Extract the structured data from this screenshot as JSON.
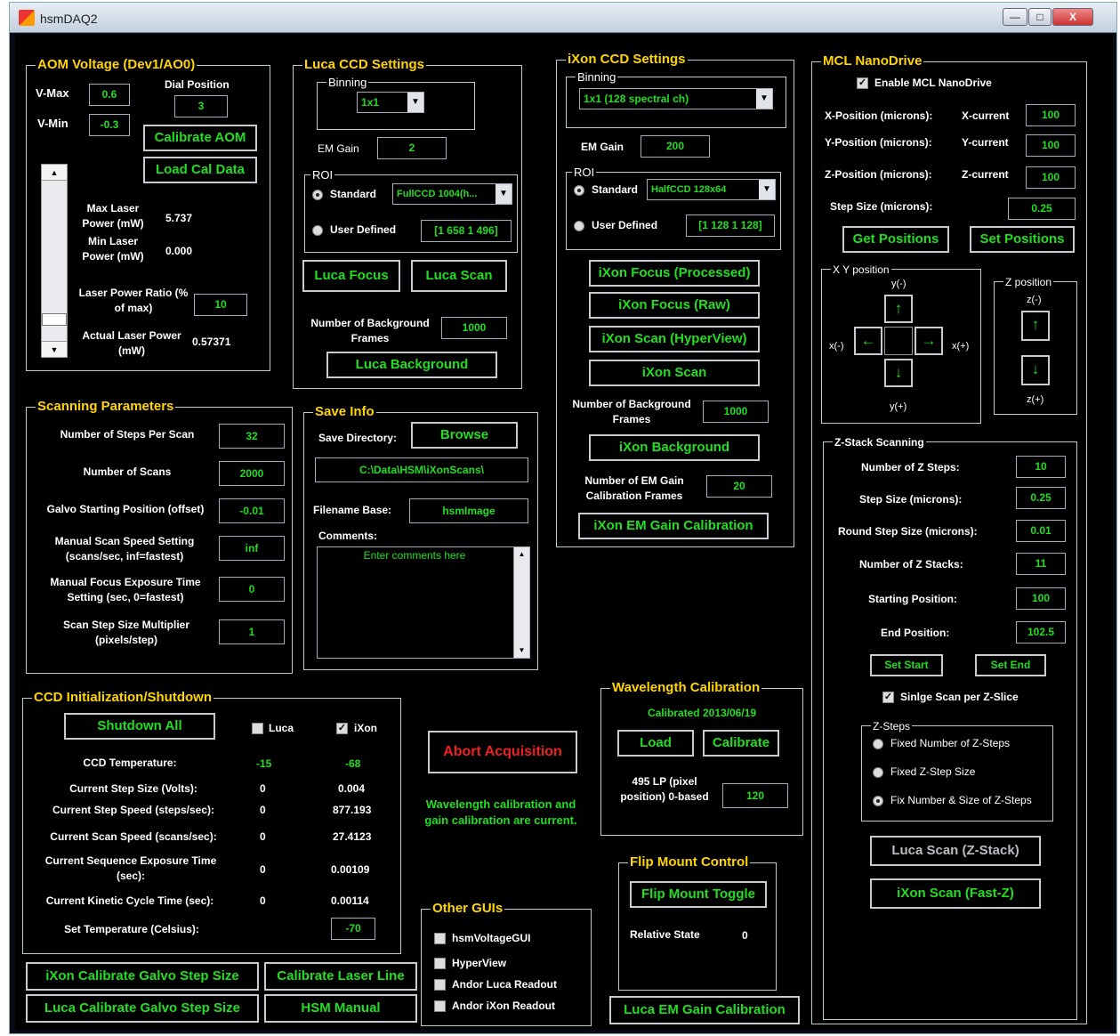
{
  "window": {
    "title": "hsmDAQ2",
    "min": "—",
    "max": "□",
    "close": "X"
  },
  "aom": {
    "title": "AOM Voltage (Dev1/AO0)",
    "vmax_label": "V-Max",
    "vmax": "0.6",
    "vmin_label": "V-Min",
    "vmin": "-0.3",
    "dial_label": "Dial Position",
    "dial": "3",
    "calibrate": "Calibrate AOM",
    "load": "Load Cal Data",
    "max_label": "Max Laser Power (mW)",
    "max": "5.737",
    "min_label": "Min Laser Power (mW)",
    "min": "0.000",
    "ratio_label": "Laser Power Ratio (% of max)",
    "ratio": "10",
    "actual_label": "Actual Laser Power (mW)",
    "actual": "0.57371",
    "slider_up": "▲",
    "slider_down": "▼",
    "slider_level": 0.1
  },
  "luca": {
    "title": "Luca CCD Settings",
    "binning_title": "Binning",
    "binning": "1x1",
    "emgain_label": "EM Gain",
    "emgain": "2",
    "roi_title": "ROI",
    "standard_label": "Standard",
    "standard_value": "FullCCD 1004(h...",
    "user_label": "User Defined",
    "user_value": "[1 658 1 496]",
    "focus": "Luca Focus",
    "scan": "Luca Scan",
    "bg_label": "Number of Background Frames",
    "bg": "1000",
    "background": "Luca Background"
  },
  "ixon": {
    "title": "iXon CCD Settings",
    "binning_title": "Binning",
    "binning": "1x1  (128 spectral ch)",
    "emgain_label": "EM Gain",
    "emgain": "200",
    "roi_title": "ROI",
    "standard_label": "Standard",
    "standard_value": "HalfCCD 128x64",
    "user_label": "User Defined",
    "user_value": "[1 128 1 128]",
    "focus_processed": "iXon Focus (Processed)",
    "focus_raw": "iXon Focus (Raw)",
    "scan_hyper": "iXon Scan (HyperView)",
    "scan": "iXon Scan",
    "bg_label": "Number of Background Frames",
    "bg": "1000",
    "background": "iXon Background",
    "emcal_label": "Number of EM Gain Calibration Frames",
    "emcal": "20",
    "emcal_btn": "iXon EM Gain Calibration"
  },
  "mcl": {
    "title": "MCL NanoDrive",
    "enable": "Enable MCL NanoDrive",
    "xpos_label": "X-Position (microns):",
    "xcur_label": "X-current",
    "xcur": "100",
    "ypos_label": "Y-Position  (microns):",
    "ycur_label": "Y-current",
    "ycur": "100",
    "zpos_label": "Z-Position  (microns):",
    "zcur_label": "Z-current",
    "zcur": "100",
    "step_label": "Step Size (microns):",
    "step": "0.25",
    "get": "Get Positions",
    "set": "Set Positions",
    "xy_title": "X Y position",
    "y_minus": "y(-)",
    "y_plus": "y(+)",
    "x_minus": "x(-)",
    "x_plus": "x(+)",
    "z_title": "Z position",
    "z_minus": "z(-)",
    "z_plus": "z(+)",
    "up": "↑",
    "down": "↓",
    "left": "←",
    "right": "→"
  },
  "zstack": {
    "title": "Z-Stack Scanning",
    "nsteps_label": "Number of Z Steps:",
    "nsteps": "10",
    "step_label": "Step Size (microns):",
    "step": "0.25",
    "round_label": "Round Step Size (microns):",
    "round": "0.01",
    "nstacks_label": "Number of Z Stacks:",
    "nstacks": "11",
    "start_label": "Starting Position:",
    "start": "100",
    "end_label": "End Position:",
    "end": "102.5",
    "set_start": "Set Start",
    "set_end": "Set End",
    "single": "Sinlge Scan per Z-Slice",
    "zsteps_title": "Z-Steps",
    "opt1": "Fixed Number of Z-Steps",
    "opt2": "Fixed Z-Step Size",
    "opt3": "Fix Number & Size of Z-Steps",
    "luca_zstack": "Luca Scan (Z-Stack)",
    "ixon_fastz": "iXon Scan (Fast-Z)"
  },
  "scan": {
    "title": "Scanning Parameters",
    "steps_label": "Number of Steps Per Scan",
    "steps": "32",
    "nscans_label": "Number of Scans",
    "nscans": "2000",
    "galvo_label": "Galvo Starting Position (offset)",
    "galvo": "-0.01",
    "speed_label": "Manual Scan Speed Setting (scans/sec, inf=fastest)",
    "speed": "inf",
    "exposure_label": "Manual Focus Exposure Time Setting (sec, 0=fastest)",
    "exposure": "0",
    "mult_label": "Scan Step Size Multiplier (pixels/step)",
    "mult": "1"
  },
  "save": {
    "title": "Save Info",
    "dir_label": "Save Directory:",
    "browse": "Browse",
    "dir": "C:\\Data\\HSM\\iXonScans\\",
    "base_label": "Filename Base:",
    "base": "hsmImage",
    "comments_label": "Comments:",
    "comments": "Enter comments here"
  },
  "ccd": {
    "title": "CCD Initialization/Shutdown",
    "shutdown": "Shutdown All",
    "luca": "Luca",
    "ixon": "iXon",
    "rows": [
      {
        "label": "CCD Temperature:",
        "luca": "-15",
        "ixon": "-68"
      },
      {
        "label": "Current Step Size (Volts):",
        "luca": "0",
        "ixon": "0.004"
      },
      {
        "label": "Current Step Speed (steps/sec):",
        "luca": "0",
        "ixon": "877.193"
      },
      {
        "label": "Current Scan Speed (scans/sec):",
        "luca": "0",
        "ixon": "27.4123"
      },
      {
        "label": "Current Sequence Exposure Time (sec):",
        "luca": "0",
        "ixon": "0.00109"
      },
      {
        "label": "Current Kinetic Cycle Time (sec):",
        "luca": "0",
        "ixon": "0.00114"
      }
    ],
    "settemp_label": "Set Temperature (Celsius):",
    "settemp": "-70"
  },
  "abort": "Abort Acquisition",
  "status": "Wavelength calibration and gain calibration are current.",
  "wave": {
    "title": "Wavelength Calibration",
    "calibrated": "Calibrated 2013/06/19",
    "load": "Load",
    "calibrate": "Calibrate",
    "lp_label": "495 LP (pixel position) 0-based",
    "lp": "120"
  },
  "flip": {
    "title": "Flip Mount Control",
    "toggle": "Flip Mount Toggle",
    "state_label": "Relative State",
    "state": "0"
  },
  "other": {
    "title": "Other GUIs",
    "items": [
      "hsmVoltageGUI",
      "HyperView",
      "Andor Luca Readout",
      "Andor iXon Readout"
    ]
  },
  "bottom": {
    "ixon_galvo": "iXon Calibrate Galvo Step Size",
    "laser_line": "Calibrate Laser Line",
    "luca_galvo": "Luca Calibrate Galvo Step Size",
    "manual": "HSM Manual",
    "luca_em": "Luca EM Gain Calibration"
  }
}
